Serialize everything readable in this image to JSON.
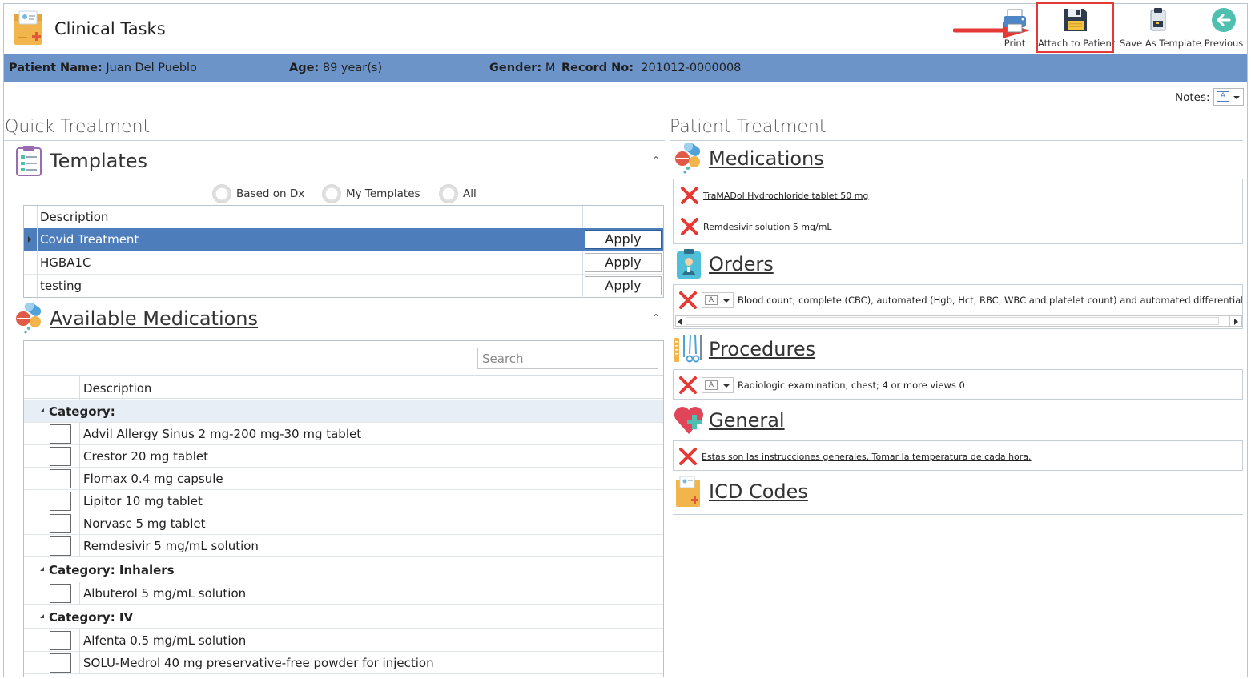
{
  "app": {
    "title": "Clinical Tasks"
  },
  "toolbar": {
    "print": "Print",
    "attach": "Attach to Patient",
    "save_template": "Save As Template",
    "previous": "Previous"
  },
  "patient": {
    "name_label": "Patient Name:",
    "name": "Juan Del Pueblo",
    "age_label": "Age:",
    "age": "89 year(s)",
    "gender_label": "Gender:",
    "gender": "M",
    "record_label": "Record No:",
    "record": "201012-0000008"
  },
  "notes": {
    "label": "Notes:"
  },
  "quick": {
    "title": "Quick Treatment",
    "templates": {
      "title": "Templates",
      "radios": [
        "Based on Dx",
        "My Templates",
        "All"
      ],
      "col_description": "Description",
      "rows": [
        {
          "description": "Covid Treatment",
          "action": "Apply"
        },
        {
          "description": "HGBA1C",
          "action": "Apply"
        },
        {
          "description": "testing",
          "action": "Apply"
        }
      ]
    },
    "medications": {
      "title": "Available Medications",
      "search_placeholder": "Search",
      "col_description": "Description",
      "categories": [
        {
          "label": "Category:",
          "items": [
            "Advil Allergy Sinus 2 mg-200 mg-30 mg tablet",
            "Crestor 20 mg tablet",
            "Flomax 0.4 mg capsule",
            "Lipitor 10 mg tablet",
            "Norvasc 5 mg tablet",
            "Remdesivir 5 mg/mL solution"
          ]
        },
        {
          "label": "Category: Inhalers",
          "items": [
            "Albuterol 5 mg/mL solution"
          ]
        },
        {
          "label": "Category: IV",
          "items": [
            "Alfenta 0.5 mg/mL solution",
            "SOLU-Medrol 40 mg preservative-free powder for injection"
          ]
        }
      ]
    }
  },
  "patient_treatment": {
    "title": "Patient Treatment",
    "medications": {
      "title": "Medications",
      "items": [
        "TraMADol Hydrochloride tablet 50 mg",
        "Remdesivir solution 5 mg/mL"
      ]
    },
    "orders": {
      "title": "Orders",
      "items": [
        "Blood count; complete (CBC), automated (Hgb, Hct, RBC, WBC and platelet count) and automated differential WBC count"
      ]
    },
    "procedures": {
      "title": "Procedures",
      "items": [
        "Radiologic examination, chest; 4 or more views 0"
      ]
    },
    "general": {
      "title": "General",
      "items": [
        "Estas son las instrucciones generales. Tomar la temperatura de cada hora."
      ]
    },
    "icd": {
      "title": "ICD Codes"
    }
  },
  "colors": {
    "patient_bar": "#6d94c9",
    "selected_row": "#4e7dbc",
    "highlight": "#e53935",
    "remove": "#e53935"
  }
}
